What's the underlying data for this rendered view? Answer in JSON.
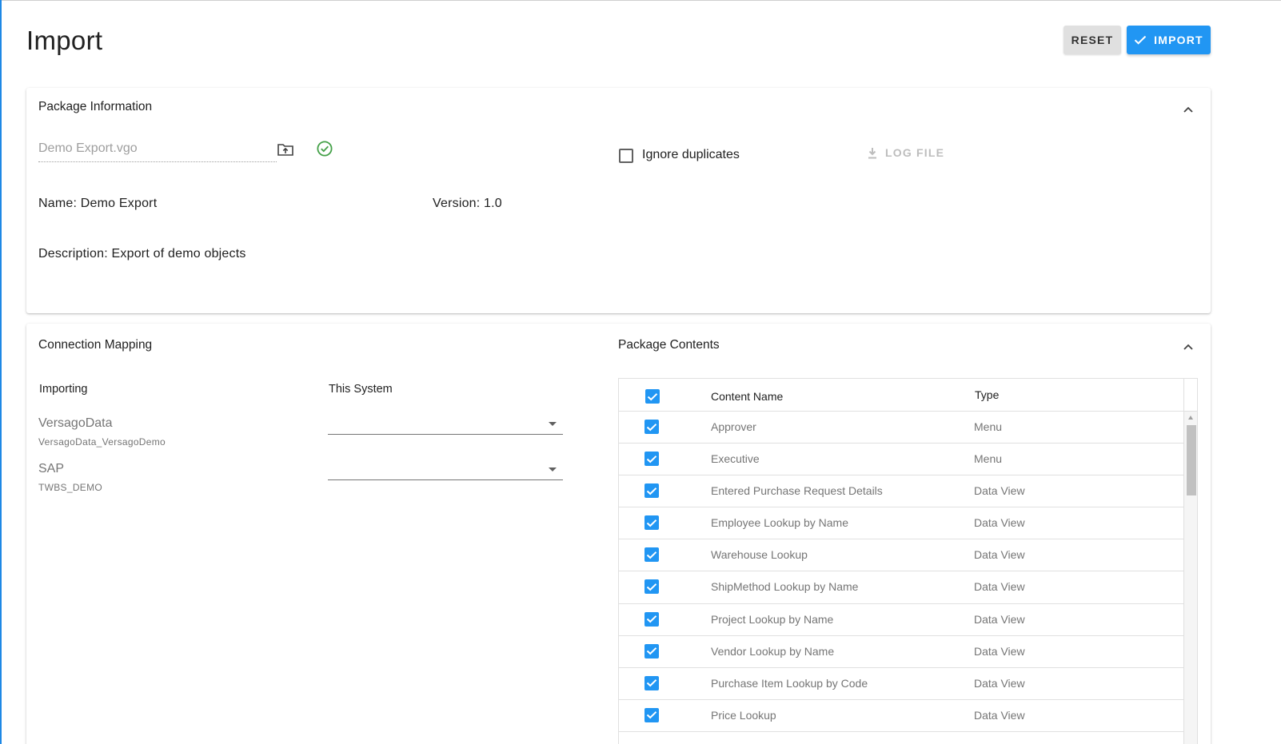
{
  "page": {
    "title": "Import",
    "accent_color": "#2196f3"
  },
  "toolbar": {
    "reset_label": "RESET",
    "import_label": "IMPORT"
  },
  "package_info": {
    "title": "Package Information",
    "file_placeholder": "Demo Export.vgo",
    "ignore_duplicates_label": "Ignore duplicates",
    "ignore_duplicates_checked": false,
    "log_file_label": "LOG FILE",
    "name_text": "Name: Demo Export",
    "version_text": "Version: 1.0",
    "description_text": "Description: Export of demo objects"
  },
  "connection_mapping": {
    "title": "Connection Mapping",
    "col_importing": "Importing",
    "col_this_system": "This System",
    "connections": [
      {
        "name": "VersagoData",
        "sub": "VersagoData_VersagoDemo",
        "selected": ""
      },
      {
        "name": "SAP",
        "sub": "TWBS_DEMO",
        "selected": ""
      }
    ]
  },
  "package_contents": {
    "title": "Package Contents",
    "col_name": "Content Name",
    "col_type": "Type",
    "rows": [
      {
        "name": "Approver",
        "type": "Menu",
        "checked": true
      },
      {
        "name": "Executive",
        "type": "Menu",
        "checked": true
      },
      {
        "name": "Entered Purchase Request Details",
        "type": "Data View",
        "checked": true
      },
      {
        "name": "Employee Lookup by Name",
        "type": "Data View",
        "checked": true
      },
      {
        "name": "Warehouse Lookup",
        "type": "Data View",
        "checked": true
      },
      {
        "name": "ShipMethod Lookup by Name",
        "type": "Data View",
        "checked": true
      },
      {
        "name": "Project Lookup by Name",
        "type": "Data View",
        "checked": true
      },
      {
        "name": "Vendor Lookup by Name",
        "type": "Data View",
        "checked": true
      },
      {
        "name": "Purchase Item Lookup by Code",
        "type": "Data View",
        "checked": true
      },
      {
        "name": "Price Lookup",
        "type": "Data View",
        "checked": true
      }
    ]
  }
}
